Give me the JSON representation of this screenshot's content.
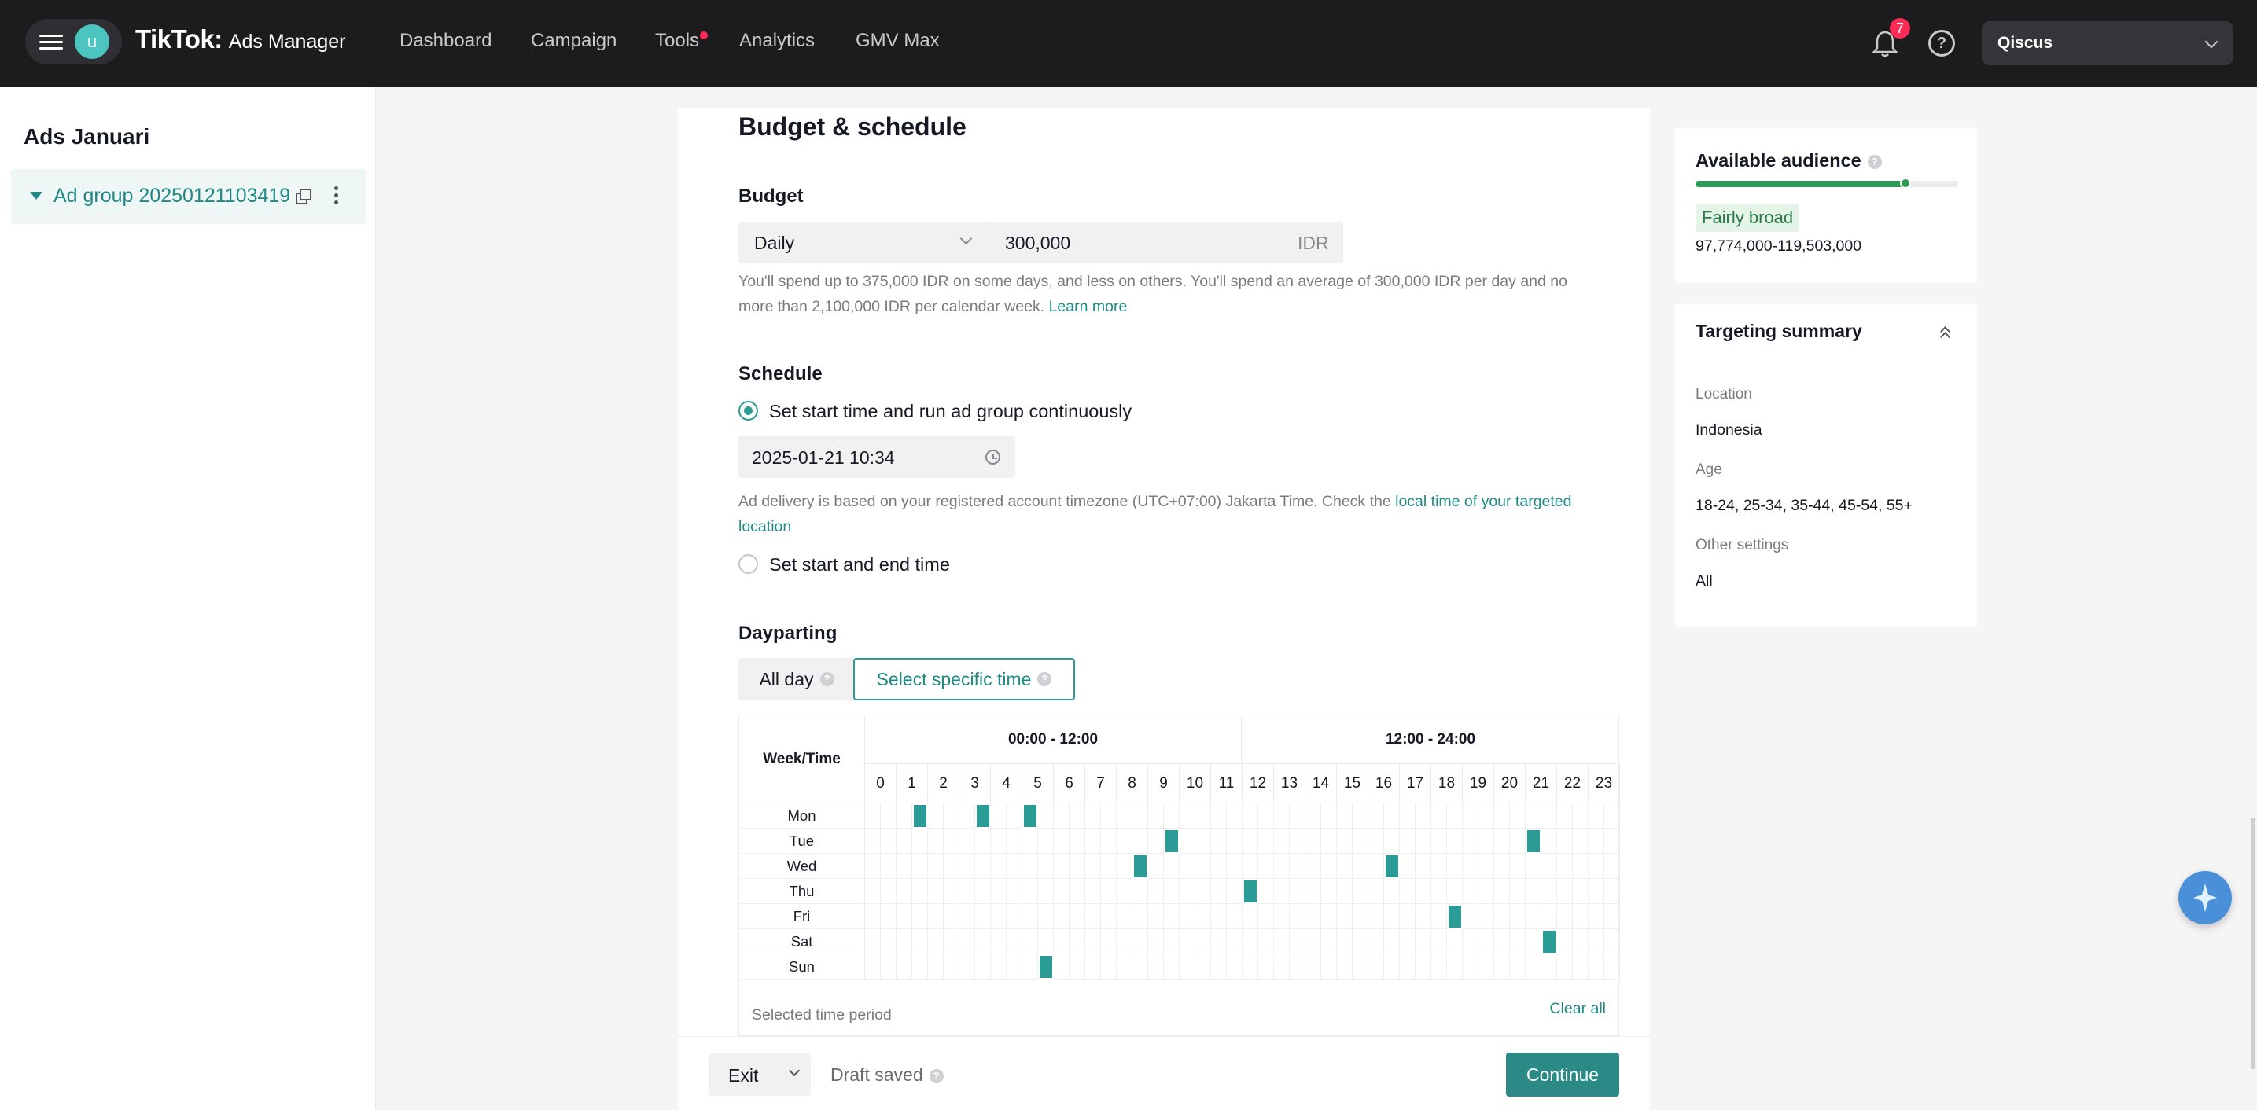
{
  "topbar": {
    "avatar_letter": "u",
    "brand_name": "TikTok:",
    "brand_sub": "Ads Manager",
    "nav": [
      "Dashboard",
      "Campaign",
      "Tools",
      "Analytics",
      "GMV Max"
    ],
    "notification_count": "7",
    "help_glyph": "?",
    "account_name": "Qiscus"
  },
  "sidebar": {
    "campaign_name": "Ads Januari",
    "ad_group_label": "Ad group 20250121103419"
  },
  "budget_schedule": {
    "section_title": "Budget & schedule",
    "budget_label": "Budget",
    "budget_mode": "Daily",
    "budget_amount": "300,000",
    "budget_currency": "IDR",
    "budget_helper": "You'll spend up to 375,000 IDR on some days, and less on others. You'll spend an average of 300,000 IDR per day and no more than 2,100,000 IDR per calendar week.",
    "learn_more": "Learn more",
    "schedule_label": "Schedule",
    "option_continuous": "Set start time and run ad group continuously",
    "start_time": "2025-01-21 10:34",
    "timezone_helper": "Ad delivery is based on your registered account timezone (UTC+07:00) Jakarta Time. Check the",
    "timezone_link": "local time of your targeted location",
    "option_start_end": "Set start and end time"
  },
  "dayparting": {
    "label": "Dayparting",
    "tab_all_day": "All day",
    "tab_specific": "Select specific time",
    "week_time_header": "Week/Time",
    "am_header": "00:00 - 12:00",
    "pm_header": "12:00 - 24:00",
    "hours": [
      "0",
      "1",
      "2",
      "3",
      "4",
      "5",
      "6",
      "7",
      "8",
      "9",
      "10",
      "11",
      "12",
      "13",
      "14",
      "15",
      "16",
      "17",
      "18",
      "19",
      "20",
      "21",
      "22",
      "23"
    ],
    "days": [
      "Mon",
      "Tue",
      "Wed",
      "Thu",
      "Fri",
      "Sat",
      "Sun"
    ],
    "selected_half_hour_slots": {
      "Mon": [
        3,
        7,
        10
      ],
      "Tue": [
        19,
        42
      ],
      "Wed": [
        17,
        33
      ],
      "Thu": [
        24
      ],
      "Fri": [
        37
      ],
      "Sat": [
        43
      ],
      "Sun": [
        11
      ]
    },
    "selected_period_label": "Selected time period",
    "clear_all": "Clear all"
  },
  "footer": {
    "exit": "Exit",
    "draft_status": "Draft saved",
    "continue": "Continue"
  },
  "audience": {
    "title": "Available audience",
    "level_fraction": 0.8,
    "level_label": "Fairly broad",
    "range": "97,774,000-119,503,000"
  },
  "targeting": {
    "title": "Targeting summary",
    "location_label": "Location",
    "location_value": "Indonesia",
    "age_label": "Age",
    "age_value": "18-24, 25-34, 35-44, 45-54, 55+",
    "other_label": "Other settings",
    "other_value": "All"
  },
  "colors": {
    "accent": "#2b9b95",
    "topbar": "#1c1c1e",
    "notification": "#fe2c55",
    "audience_bar": "#2b9b55"
  },
  "icons": [
    "hamburger-icon",
    "bell-icon",
    "help-icon",
    "chevron-down-icon",
    "copy-icon",
    "more-icon",
    "clock-icon",
    "question-icon",
    "collapse-icon",
    "ai-sparkle-icon"
  ]
}
